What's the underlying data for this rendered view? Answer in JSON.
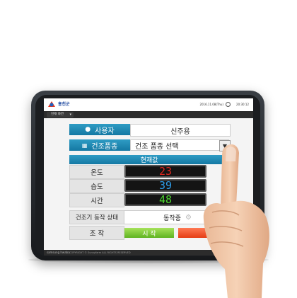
{
  "topbar": {
    "app_name": "홍천군",
    "date": "2016.11.08(Thu)",
    "time": "20:30:12"
  },
  "menubar": {
    "menu_label": "현재 화면"
  },
  "form": {
    "user_label": "사용자",
    "user_value": "신주용",
    "variety_label": "건조품종",
    "variety_value": "건조 품종 선택",
    "current_header": "현재값"
  },
  "readings": [
    {
      "label": "온도",
      "value": "23",
      "color": "#e0261e"
    },
    {
      "label": "습도",
      "value": "39",
      "color": "#2e9be6"
    },
    {
      "label": "시간",
      "value": "48",
      "color": "#4cd42e"
    }
  ],
  "status": {
    "label": "건조기 동작 상태",
    "value": "동작중"
  },
  "control": {
    "label": "조 작",
    "start_label": "시 작"
  },
  "footer": {
    "brand": "samsung hwaba",
    "copyright": "COPYRIGHT © Sunnyfarm ALL RIGHTS RESERVED"
  },
  "icons": [
    "logo-icon",
    "clock-icon",
    "user-icon",
    "grid-icon",
    "chevron-down-icon",
    "gear-icon"
  ],
  "colors": {
    "header_blue": "#1f8ab9",
    "start_green": "#6fc02d",
    "stop_red": "#e8461c"
  }
}
